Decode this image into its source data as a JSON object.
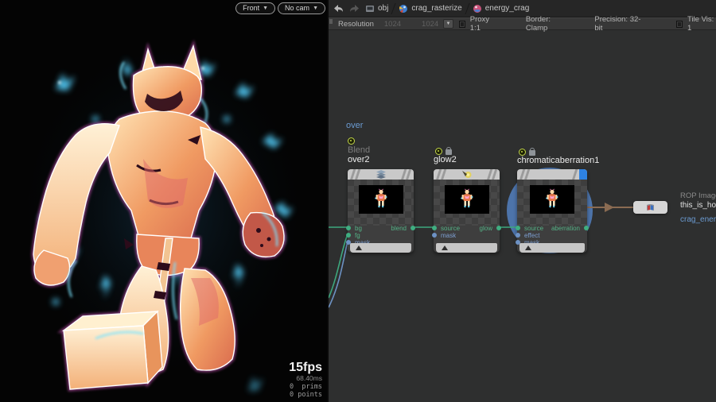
{
  "viewport": {
    "view_menu": "Front",
    "camera_menu": "No cam",
    "stats": {
      "fps": "15fps",
      "frame_time": "68.40ms",
      "prims": "0  prims",
      "points": "0 points"
    }
  },
  "editor": {
    "tabs": {
      "path": [
        {
          "label": "obj"
        },
        {
          "label": "crag_rasterize"
        },
        {
          "label": "energy_crag"
        }
      ]
    },
    "toolbar": {
      "resolution_label": "Resolution",
      "res_width": "1024",
      "res_height": "1024",
      "proxy_label": "Proxy 1:1",
      "border_label": "Border: Clamp",
      "precision_label": "Precision: 32-bit",
      "tile_vis_label": "Tile Vis: 1"
    },
    "network": {
      "parent_label": "over",
      "nodes": [
        {
          "type_label": "Blend",
          "name": "over2",
          "inputs": [
            "bg",
            "fg",
            "mask"
          ],
          "output": "blend"
        },
        {
          "name": "glow2",
          "inputs": [
            "source",
            "mask"
          ],
          "output": "glow"
        },
        {
          "name": "chromaticaberration1",
          "inputs": [
            "source",
            "effect",
            "mask"
          ],
          "output": "aberration"
        }
      ],
      "rop_node": {
        "type_label": "ROP Image",
        "name": "this_is_ho",
        "network_label": "crag_energ"
      }
    }
  },
  "colors": {
    "accent_blue": "#6b9bd2",
    "wire_green": "#3da87e",
    "wire_blue": "#6d92c4",
    "wire_rop": "#8a6b52",
    "selection_halo": "#4d74aa",
    "display_flag": "#2e82e2",
    "flag_yellow": "#c2d64a"
  }
}
